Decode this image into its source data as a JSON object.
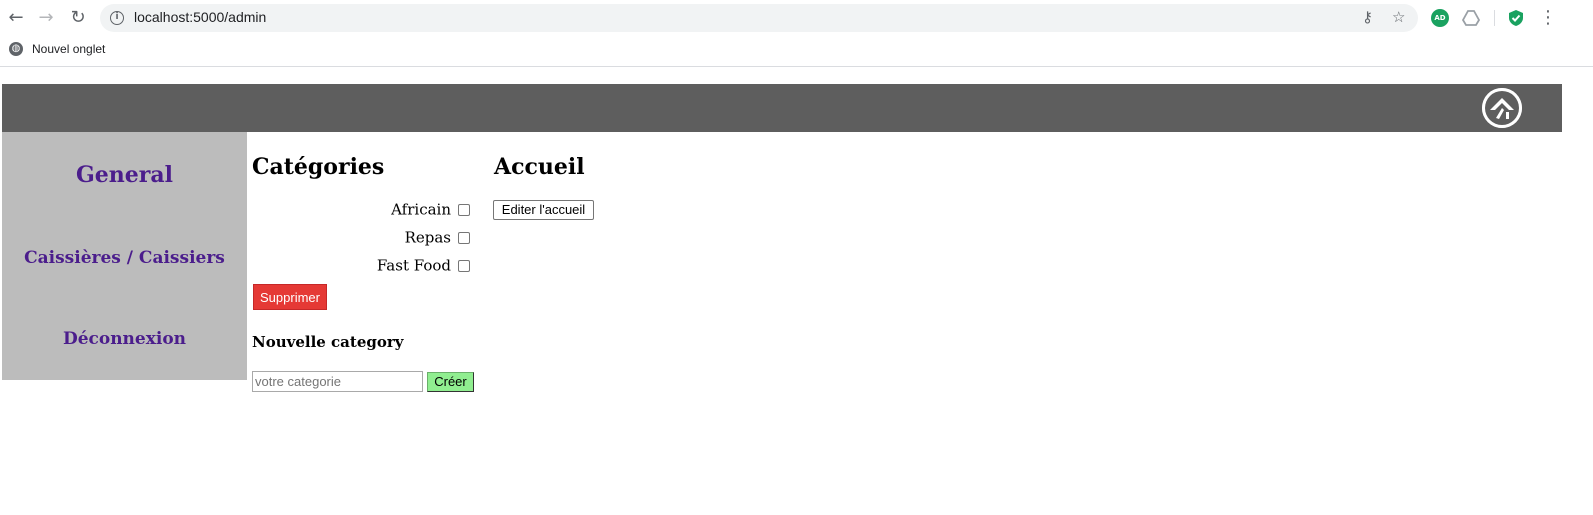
{
  "browser": {
    "url": "localhost:5000/admin",
    "back_icon": "←",
    "forward_icon": "→",
    "reload_icon": "↻",
    "info_icon": "i",
    "key_icon": "⚷",
    "star_icon": "☆",
    "ext_adblock": "AD",
    "menu_icon": "⋮",
    "bookmark_label": "Nouvel onglet",
    "bookmark_icon": "◍"
  },
  "sidebar": {
    "general": "General",
    "caisse": "Caissières / Caissiers",
    "deconnexion": "Déconnexion"
  },
  "categories": {
    "title": "Catégories",
    "items": [
      {
        "label": "Africain",
        "checked": false
      },
      {
        "label": "Repas",
        "checked": false
      },
      {
        "label": "Fast Food",
        "checked": false
      }
    ],
    "delete_label": "Supprimer",
    "new_title": "Nouvelle category",
    "input_placeholder": "votre categorie",
    "create_label": "Créer"
  },
  "accueil": {
    "title": "Accueil",
    "edit_label": "Editer l'accueil"
  },
  "colors": {
    "header": "#5e5e5e",
    "sidebar": "#bcbcbc",
    "link": "#4b1d8c",
    "delete": "#e53935",
    "create": "#90ee90"
  }
}
